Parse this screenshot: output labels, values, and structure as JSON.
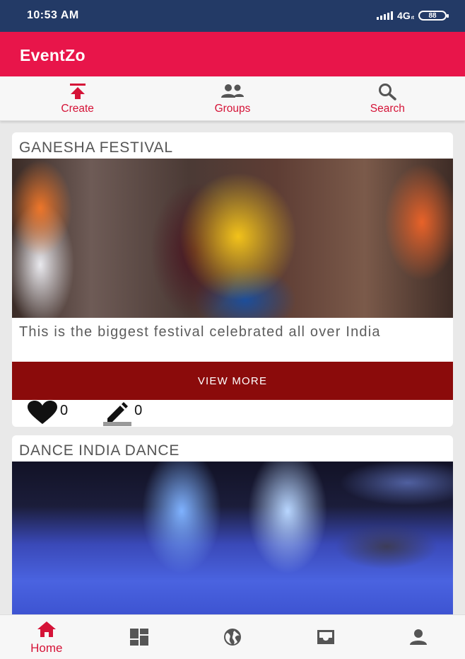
{
  "status_bar": {
    "time": "10:53 AM",
    "network": "4G",
    "network_sub": "ıt",
    "battery": "88"
  },
  "app_bar": {
    "title": "EventZo"
  },
  "top_tabs": [
    {
      "label": "Create",
      "icon": "upload-icon"
    },
    {
      "label": "Groups",
      "icon": "groups-icon"
    },
    {
      "label": "Search",
      "icon": "search-icon"
    }
  ],
  "events": [
    {
      "title": "GANESHA FESTIVAL",
      "description": "This is the biggest festival celebrated all over India",
      "view_more_label": "VIEW MORE",
      "likes": "0",
      "edits": "0"
    },
    {
      "title": "DANCE INDIA DANCE"
    }
  ],
  "bottom_nav": {
    "active_label": "Home",
    "items": [
      "home-icon",
      "dashboard-icon",
      "globe-icon",
      "inbox-icon",
      "profile-icon"
    ]
  },
  "colors": {
    "status_bar": "#233a66",
    "app_bar": "#e8154a",
    "accent": "#d51337",
    "view_more": "#8b0b0b"
  }
}
